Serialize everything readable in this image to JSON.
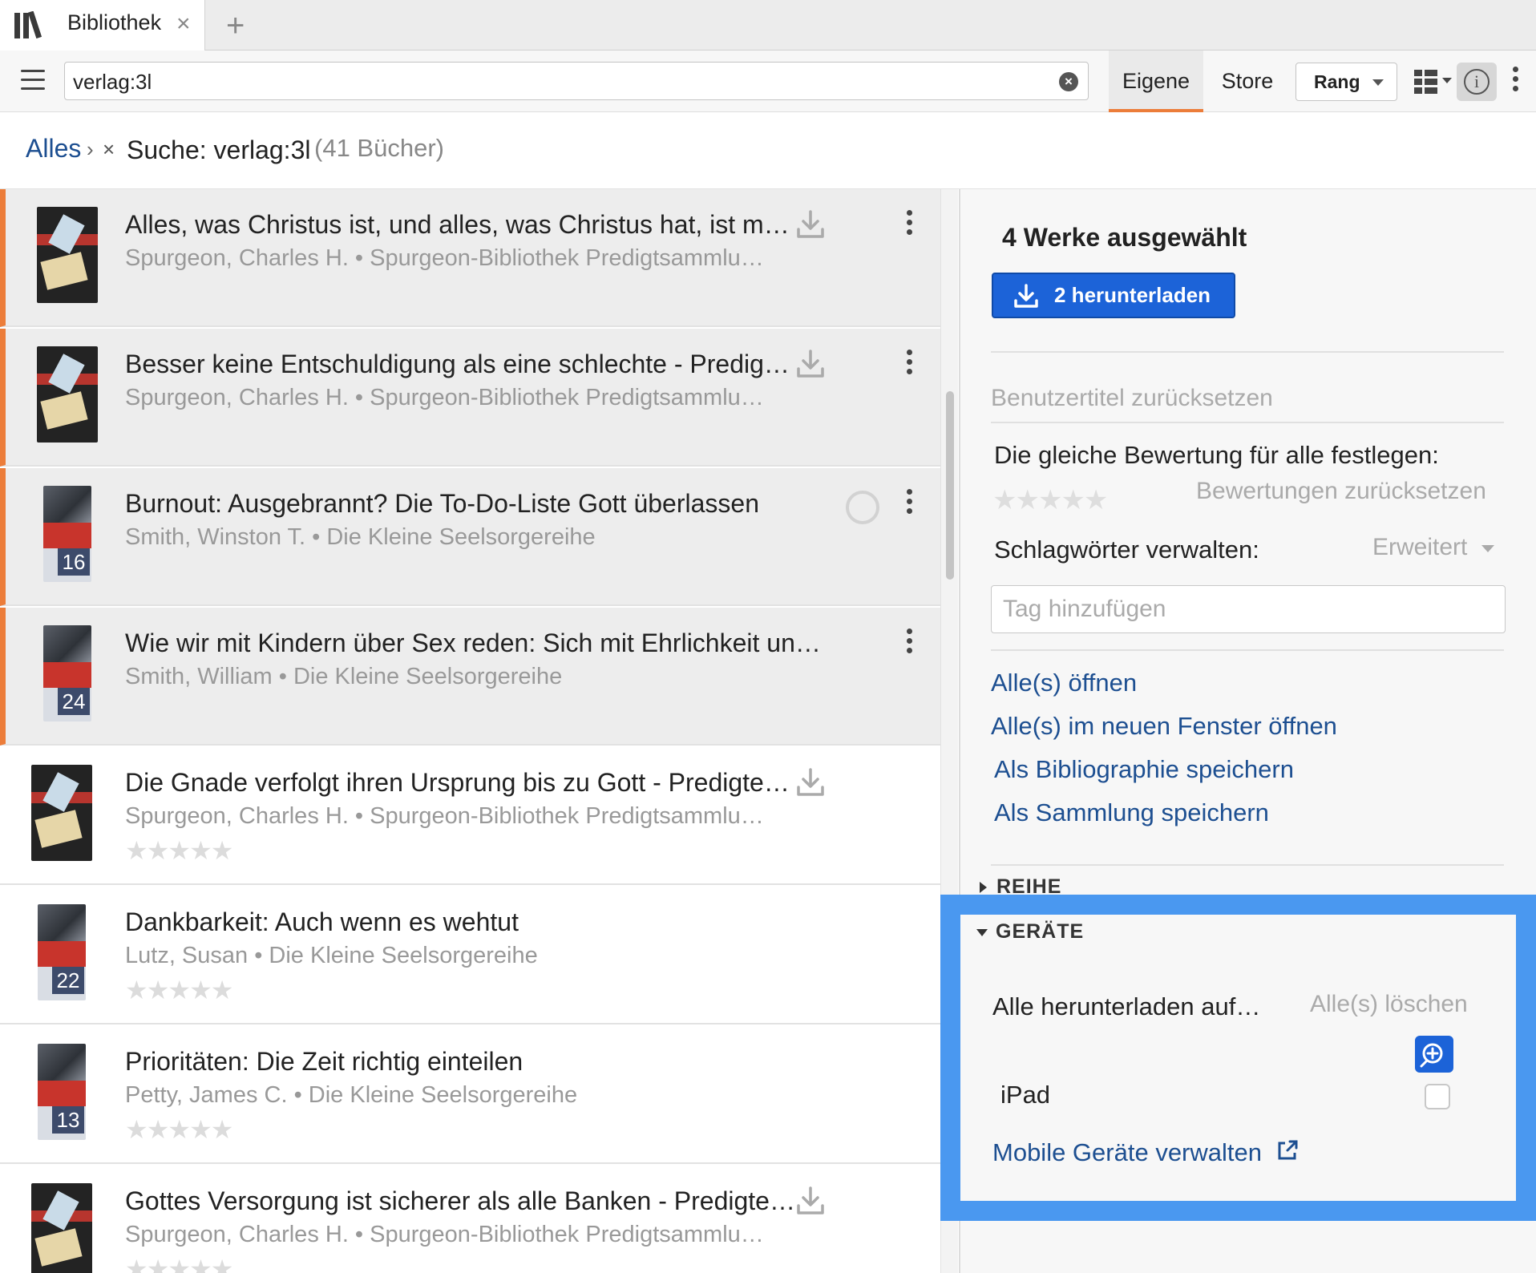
{
  "tab": {
    "title": "Bibliothek",
    "close": "×",
    "add": "+"
  },
  "toolbar": {
    "search_value": "verlag:3l",
    "segments": {
      "own": "Eigene",
      "store": "Store"
    },
    "sort_label": "Rang"
  },
  "breadcrumb": {
    "all": "Alles",
    "sep": "›",
    "remove": "×",
    "search": "Suche: verlag:3l",
    "count": "(41 Bücher)"
  },
  "books": [
    {
      "title": "Alles, was Christus ist, und alles, was Christus hat, ist m…",
      "subtitle": "Spurgeon, Charles H. • Spurgeon-Bibliothek Predigtsammlu…",
      "selected": true,
      "cover": "dark",
      "status": "download"
    },
    {
      "title": "Besser keine Entschuldigung als eine schlechte - Predig…",
      "subtitle": "Spurgeon, Charles H. • Spurgeon-Bibliothek Predigtsammlu…",
      "selected": true,
      "cover": "dark",
      "status": "download"
    },
    {
      "title": "Burnout: Ausgebrannt? Die To-Do-Liste Gott überlassen",
      "subtitle": "Smith, Winston T. • Die Kleine Seelsorgereihe",
      "selected": true,
      "cover": "light",
      "cover_number": "16",
      "status": "loading"
    },
    {
      "title": "Wie wir mit Kindern über Sex reden: Sich mit Ehrlichkeit un…",
      "subtitle": "Smith, William • Die Kleine Seelsorgereihe",
      "selected": true,
      "cover": "light",
      "cover_number": "24",
      "status": "none"
    },
    {
      "title": "Die Gnade verfolgt ihren Ursprung bis zu Gott - Predigte…",
      "subtitle": "Spurgeon, Charles H. • Spurgeon-Bibliothek Predigtsammlu…",
      "selected": false,
      "cover": "dark",
      "status": "download",
      "stars": "★★★★★"
    },
    {
      "title": "Dankbarkeit: Auch wenn es wehtut",
      "subtitle": "Lutz, Susan • Die Kleine Seelsorgereihe",
      "selected": false,
      "cover": "light",
      "cover_number": "22",
      "status": "none",
      "stars": "★★★★★"
    },
    {
      "title": "Prioritäten: Die Zeit richtig einteilen",
      "subtitle": "Petty, James C. • Die Kleine Seelsorgereihe",
      "selected": false,
      "cover": "light",
      "cover_number": "13",
      "status": "none",
      "stars": "★★★★★"
    },
    {
      "title": "Gottes Versorgung ist sicherer als alle Banken - Predigte…",
      "subtitle": "Spurgeon, Charles H. • Spurgeon-Bibliothek Predigtsammlu…",
      "selected": false,
      "cover": "dark",
      "status": "download",
      "stars": "★★★★★"
    }
  ],
  "panel": {
    "heading": "4 Werke ausgewählt",
    "download_button": "2 herunterladen",
    "reset_titles": "Benutzertitel zurücksetzen",
    "rating_label": "Die gleiche Bewertung für alle festlegen:",
    "rating_stars": "★★★★★",
    "reset_ratings": "Bewertungen zurücksetzen",
    "tags_label": "Schlagwörter verwalten:",
    "tags_mode": "Erweitert",
    "tag_placeholder": "Tag hinzufügen",
    "links": {
      "open_all": "Alle(s) öffnen",
      "open_new_window": "Alle(s) im neuen Fenster öffnen",
      "save_bibliography": "Als Bibliographie speichern",
      "save_collection": "Als Sammlung speichern"
    },
    "series_section": "REIHE",
    "devices_section": "GERÄTE",
    "download_all_on": "Alle herunterladen auf…",
    "delete_all": "Alle(s) löschen",
    "device_name": "iPad",
    "manage_devices": "Mobile Geräte verwalten"
  },
  "colors": {
    "accent": "#ec7d3a",
    "primary": "#1c63d8",
    "link": "#1d4f91",
    "highlight": "#4a98f0"
  }
}
